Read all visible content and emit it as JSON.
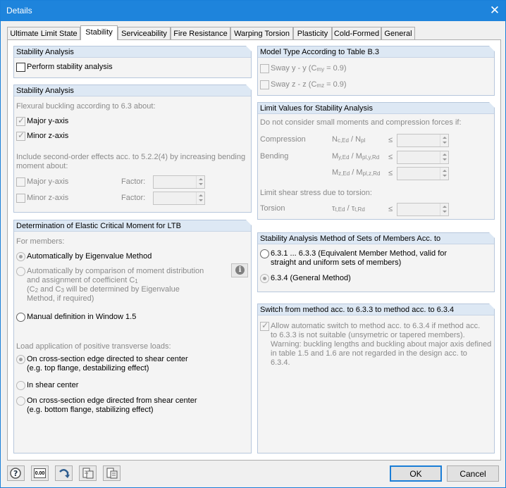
{
  "window": {
    "title": "Details",
    "close_glyph": "✕"
  },
  "tabs": [
    "Ultimate Limit State",
    "Stability",
    "Serviceability",
    "Fire Resistance",
    "Warping Torsion",
    "Plasticity",
    "Cold-Formed",
    "General"
  ],
  "active_tab": "Stability",
  "stability_analysis_1": {
    "title": "Stability Analysis",
    "perform_label": "Perform stability analysis",
    "perform_checked": false
  },
  "stability_analysis_2": {
    "title": "Stability Analysis",
    "flexural_label": "Flexural buckling according to 6.3 about:",
    "major_y": "Major y-axis",
    "minor_z": "Minor z-axis",
    "second_order_line1": "Include second-order effects acc. to 5.2.2(4) by increasing bending",
    "second_order_line2": "moment about:",
    "so_major_y": "Major y-axis",
    "so_minor_z": "Minor z-axis",
    "factor_label": "Factor:"
  },
  "ltb": {
    "title": "Determination of Elastic Critical Moment for LTB",
    "for_members": "For members:",
    "opt_eigen": "Automatically by Eigenvalue Method",
    "opt_compare_l1": "Automatically by comparison of moment distribution",
    "opt_compare_l2a": "and assignment of coefficient C",
    "opt_compare_l2sub": "1",
    "opt_compare_l3a": "(C",
    "opt_compare_l3sub1": "2",
    "opt_compare_l3b": " and C",
    "opt_compare_l3sub2": "3",
    "opt_compare_l3c": " will be determined by Eigenvalue",
    "opt_compare_l4": "Method, if required)",
    "opt_manual": "Manual definition in Window 1.5",
    "load_label": "Load application of positive transverse loads:",
    "load_shear_edge_to_l1": "On cross-section edge directed to shear center",
    "load_shear_edge_to_l2": "(e.g. top flange, destabilizing effect)",
    "load_in_shear": "In shear center",
    "load_shear_edge_from_l1": "On cross-section edge directed from shear center",
    "load_shear_edge_from_l2": "(e.g. bottom flange, stabilizing effect)"
  },
  "model_type": {
    "title": "Model Type According to Table B.3",
    "sway_y_a": "Sway y - y (C",
    "sway_y_sub": "my",
    "sway_y_b": " = 0.9)",
    "sway_z_a": "Sway z - z (C",
    "sway_z_sub": "mz",
    "sway_z_b": " = 0.9)"
  },
  "limit_values": {
    "title": "Limit Values for Stability Analysis",
    "intro": "Do not consider small moments and compression forces if:",
    "compression": "Compression",
    "comp_formula_a": "N",
    "comp_formula_sub1": "c,Ed",
    "comp_formula_b": " / N",
    "comp_formula_sub2": "pl",
    "bending": "Bending",
    "bend_y_a": "M",
    "bend_y_sub1": "y,Ed",
    "bend_y_b": " / M",
    "bend_y_sub2": "pl,y,Rd",
    "bend_z_a": "M",
    "bend_z_sub1": "z,Ed",
    "bend_z_b": " / M",
    "bend_z_sub2": "pl,z,Rd",
    "le_symbol": "≤",
    "shear_label": "Limit shear stress due to torsion:",
    "torsion": "Torsion",
    "tors_a": "τ",
    "tors_sub1": "t,Ed",
    "tors_b": " / τ",
    "tors_sub2": "t,Rd"
  },
  "method_sets": {
    "title": "Stability Analysis Method of Sets of Members Acc. to",
    "opt1_l1": "6.3.1 ... 6.3.3 (Equivalent Member Method, valid for",
    "opt1_l2": "straight and uniform sets of members)",
    "opt2": "6.3.4  (General Method)"
  },
  "switch_method": {
    "title": "Switch from method acc. to 6.3.3 to method acc. to 6.3.4",
    "l1": "Allow automatic switch to method acc. to 6.3.4 if method acc.",
    "l2": "to 6.3.3 is not suitable (unsymetric or tapered members).",
    "l3": "Warning: buckling lengths and buckling about major axis defined",
    "l4": "in table 1.5 and 1.6 are not regarded in the design acc. to",
    "l5": "6.3.4."
  },
  "footer": {
    "ok": "OK",
    "cancel": "Cancel",
    "units_icon_text": "0.00"
  },
  "icons": [
    "help-icon",
    "units-icon",
    "reset-icon",
    "import-icon",
    "export-icon",
    "info-icon"
  ]
}
